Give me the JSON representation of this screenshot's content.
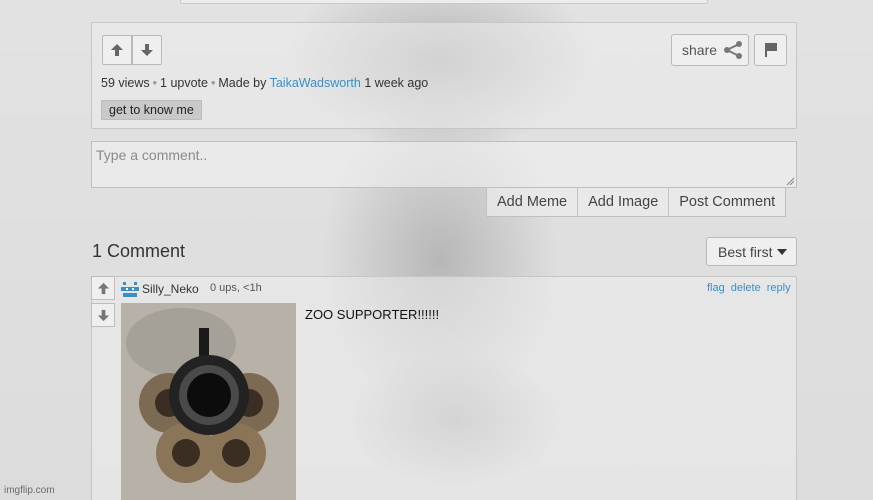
{
  "post": {
    "share_label": "share",
    "views": "59 views",
    "upvotes": "1 upvote",
    "made_by_prefix": "Made by",
    "author": "TaikaWadsworth",
    "time_ago": "1 week ago",
    "tag": "get to know me"
  },
  "comment_form": {
    "placeholder": "Type a comment..",
    "add_meme": "Add Meme",
    "add_image": "Add Image",
    "post_comment": "Post Comment"
  },
  "comments_section": {
    "heading": "1 Comment",
    "sort_label": "Best first"
  },
  "comment": {
    "username": "Silly_Neko",
    "meta": "0 ups, <1h",
    "actions": [
      "flag",
      "delete",
      "reply"
    ],
    "text": "ZOO SUPPORTER!!!!!!"
  },
  "watermark": "imgflip.com",
  "colors": {
    "link": "#3b8fc4",
    "background": "#e3e3e3",
    "tag_bg": "#c9c9c9"
  }
}
